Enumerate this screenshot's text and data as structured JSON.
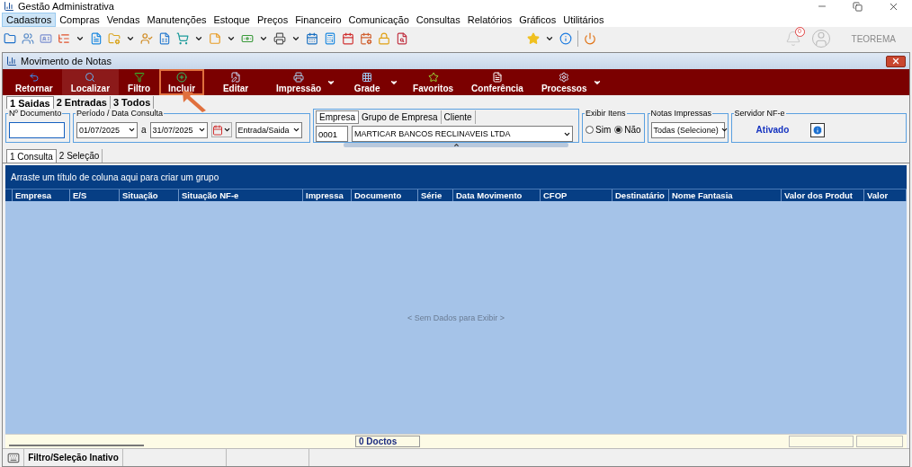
{
  "window": {
    "title": "Gestão Administrativa"
  },
  "menu": [
    {
      "label": "Cadastros",
      "selected": true
    },
    {
      "label": "Compras",
      "selected": false
    },
    {
      "label": "Vendas",
      "selected": false
    },
    {
      "label": "Manutenções",
      "selected": false
    },
    {
      "label": "Estoque",
      "selected": false
    },
    {
      "label": "Preços",
      "selected": false
    },
    {
      "label": "Financeiro",
      "selected": false
    },
    {
      "label": "Comunicação",
      "selected": false
    },
    {
      "label": "Consultas",
      "selected": false
    },
    {
      "label": "Relatórios",
      "selected": false
    },
    {
      "label": "Gráficos",
      "selected": false
    },
    {
      "label": "Utilitários",
      "selected": false
    }
  ],
  "user": {
    "notifications": "0",
    "name": "TEOREMA"
  },
  "document_window": {
    "title": "Movimento de Notas"
  },
  "actions": [
    {
      "label": "Retornar",
      "hovered": false,
      "highlighted": false,
      "dropdown": false
    },
    {
      "label": "Localizar",
      "hovered": true,
      "highlighted": false,
      "dropdown": false
    },
    {
      "label": "Filtro",
      "hovered": false,
      "highlighted": false,
      "dropdown": false
    },
    {
      "label": "Incluir",
      "hovered": false,
      "highlighted": true,
      "dropdown": false
    },
    {
      "label": "Editar",
      "hovered": false,
      "highlighted": false,
      "dropdown": false
    },
    {
      "label": "Impressão",
      "hovered": false,
      "highlighted": false,
      "dropdown": true
    },
    {
      "label": "Grade",
      "hovered": false,
      "highlighted": false,
      "dropdown": true
    },
    {
      "label": "Favoritos",
      "hovered": false,
      "highlighted": false,
      "dropdown": false
    },
    {
      "label": "Conferência",
      "hovered": false,
      "highlighted": false,
      "dropdown": false
    },
    {
      "label": "Processos",
      "hovered": false,
      "highlighted": false,
      "dropdown": true
    }
  ],
  "type_tabs": [
    {
      "label": "1 Saidas",
      "selected": true
    },
    {
      "label": "2 Entradas",
      "selected": false
    },
    {
      "label": "3 Todos",
      "selected": false
    }
  ],
  "filters": {
    "document": {
      "label": "Nº Documento"
    },
    "period": {
      "label": "Período / Data Consulta",
      "from": "01/07/2025",
      "separator": "a",
      "to": "31/07/2025",
      "direction": "Entrada/Saida"
    },
    "company": {
      "tabs": [
        {
          "label": "Empresa",
          "selected": true
        },
        {
          "label": "Grupo de Empresa",
          "selected": false
        },
        {
          "label": "Cliente",
          "selected": false
        }
      ],
      "code": "0001",
      "name": "MARTICAR BANCOS RECLINAVEIS LTDA"
    },
    "show_items": {
      "label": "Exibir Itens",
      "options": [
        {
          "label": "Sim",
          "selected": false
        },
        {
          "label": "Não",
          "selected": true
        }
      ]
    },
    "printed_notes": {
      "label": "Notas Impressas",
      "value": "Todas (Selecione)"
    },
    "nfe_server": {
      "label": "Servidor NF-e",
      "status": "Ativado"
    }
  },
  "view_tabs": [
    {
      "label": "1 Consulta",
      "selected": true
    },
    {
      "label": "2 Seleção",
      "selected": false
    }
  ],
  "grid": {
    "group_hint": "Arraste um título de coluna aqui para criar um grupo",
    "columns": [
      "Empresa",
      "E/S",
      "Situação",
      "Situação NF-e",
      "Impressa",
      "Documento",
      "Série",
      "Data Movimento",
      "CFOP",
      "Destinatário",
      "Nome Fantasia",
      "Valor dos Produt",
      "Valor"
    ],
    "empty_text": "< Sem Dados para Exibir >",
    "footer_count": "0 Doctos"
  },
  "status_bar": {
    "filter_status": "Filtro/Seleção Inativo"
  }
}
